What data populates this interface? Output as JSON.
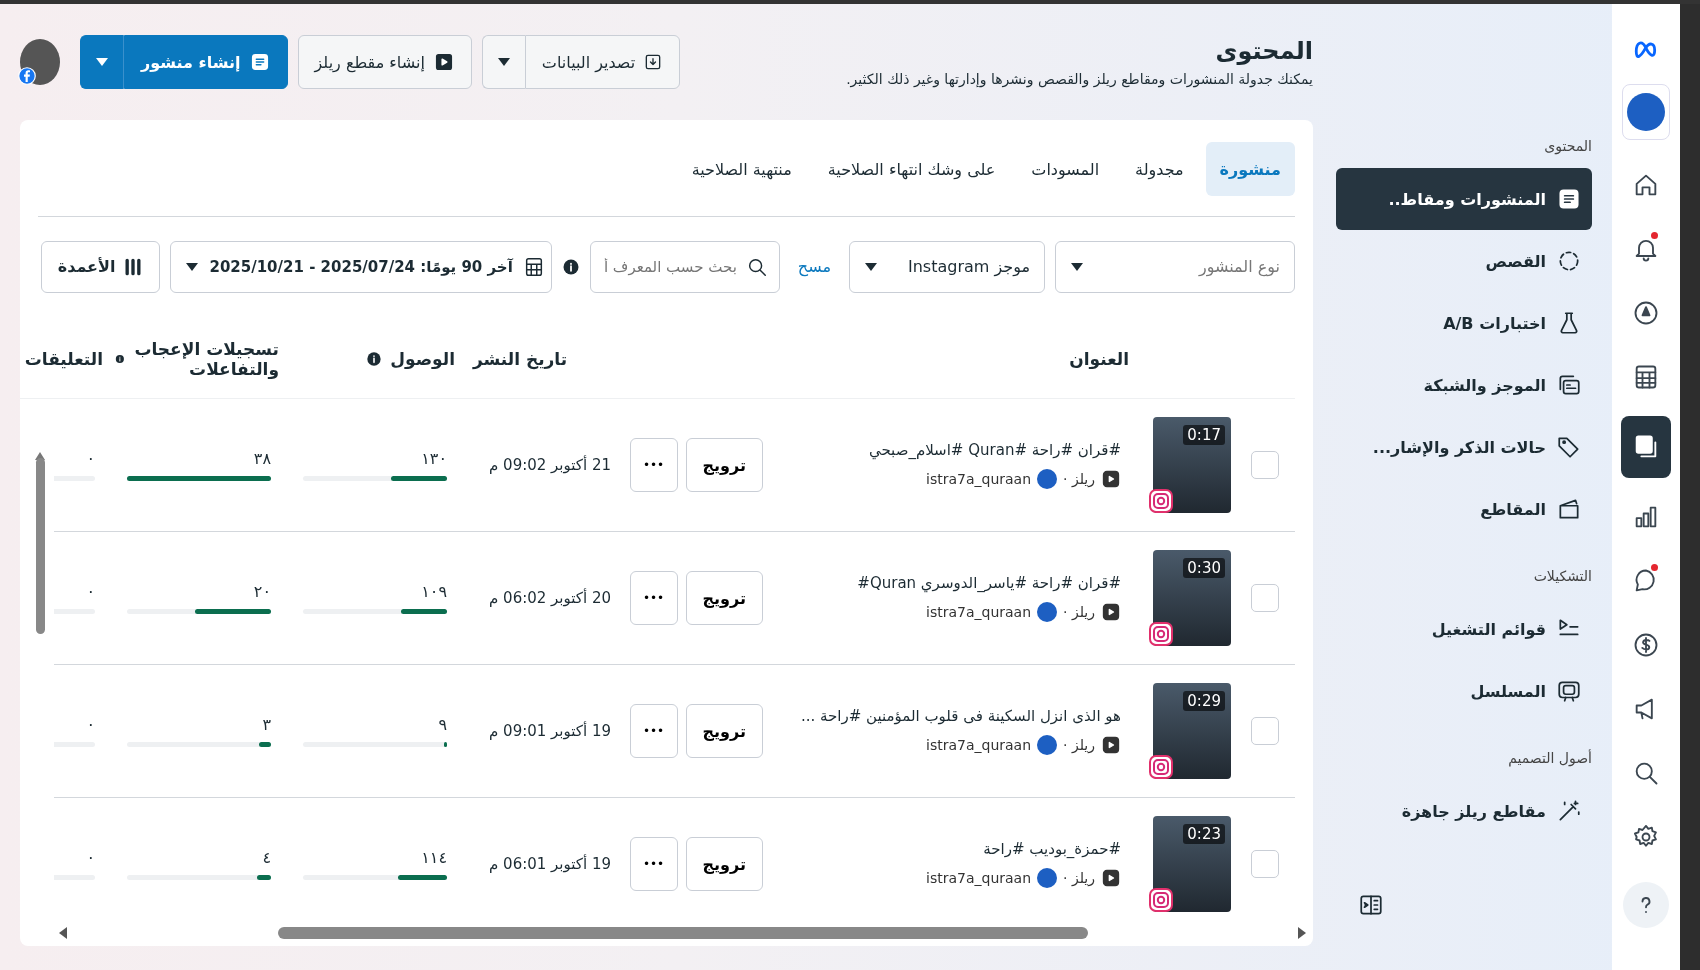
{
  "rail": {
    "items": [
      {
        "selected": false,
        "dot": false
      },
      {
        "selected": false,
        "dot": true
      },
      {
        "selected": false,
        "dot": false
      },
      {
        "selected": false,
        "dot": false
      },
      {
        "selected": true,
        "dot": false
      },
      {
        "selected": false,
        "dot": false
      },
      {
        "selected": false,
        "dot": true
      },
      {
        "selected": false,
        "dot": false
      },
      {
        "selected": false,
        "dot": false
      },
      {
        "selected": false,
        "dot": false
      },
      {
        "selected": false,
        "dot": false
      },
      {
        "selected": false,
        "dot": false
      }
    ]
  },
  "sidebar": {
    "sections": [
      {
        "heading": "المحتوى",
        "items": [
          {
            "label": "المنشورات ومقاط..",
            "selected": true
          },
          {
            "label": "القصص",
            "selected": false
          },
          {
            "label": "اختبارات A/B",
            "selected": false
          },
          {
            "label": "الموجز والشبكة",
            "selected": false
          },
          {
            "label": "حالات الذكر والإشار...",
            "selected": false
          },
          {
            "label": "المقاطع",
            "selected": false
          }
        ]
      },
      {
        "heading": "التشكيلات",
        "items": [
          {
            "label": "قوائم التشغيل",
            "selected": false
          },
          {
            "label": "المسلسل",
            "selected": false
          }
        ]
      },
      {
        "heading": "أصول التصميم",
        "items": [
          {
            "label": "مقاطع ريلز جاهزة",
            "selected": false
          }
        ]
      }
    ]
  },
  "header": {
    "title": "المحتوى",
    "subtitle": "يمكنك جدولة المنشورات ومقاطع ريلز والقصص ونشرها وإدارتها وغير ذلك الكثير.",
    "buttons": [
      {
        "kind": "split",
        "label": "تصدير البيانات"
      },
      {
        "kind": "plain",
        "label": "إنشاء مقطع ريلز"
      },
      {
        "kind": "primary",
        "label": "إنشاء منشور"
      }
    ]
  },
  "tabs": [
    {
      "label": "منشورة",
      "selected": true
    },
    {
      "label": "مجدولة",
      "selected": false
    },
    {
      "label": "المسودات",
      "selected": false
    },
    {
      "label": "على وشك انتهاء الصلاحية",
      "selected": false
    },
    {
      "label": "منتهية الصلاحية",
      "selected": false
    }
  ],
  "filters": {
    "post_type": {
      "placeholder": "نوع المنشور"
    },
    "feed": {
      "value": "موجز Instagram"
    },
    "clear_link": "مسح",
    "search": {
      "placeholder": "بحث حسب المعرف أ"
    },
    "date_range": "آخر 90 يومًا: 2025/07/24 - 2025/10/21",
    "columns_button": "الأعمدة"
  },
  "table": {
    "columns": [
      {
        "label": "العنوان"
      },
      {
        "label": "تاريخ النشر"
      },
      {
        "label": "الوصول",
        "info": true
      },
      {
        "label": "تسجيلات الإعجاب والتفاعلات",
        "info": true
      },
      {
        "label": "التعليقات"
      }
    ],
    "rows": [
      {
        "checked": false,
        "duration": "0:17",
        "title": "#قران #راحة #Quran #اسلام_صبحي",
        "type": "ريلز ·",
        "account": "istra7a_quraan",
        "promote": "ترويج",
        "more": "•••",
        "date": "21 أكتوبر 09:02 م",
        "reach": {
          "value": "١٣٠",
          "level": 0.39
        },
        "likes": {
          "value": "٣٨",
          "level": 1
        },
        "comments": {
          "value": "٠"
        }
      },
      {
        "checked": false,
        "duration": "0:30",
        "title": "#قران #راحة #ياسر_الدوسري Quran#",
        "type": "ريلز ·",
        "account": "istra7a_quraan",
        "promote": "ترويج",
        "more": "•••",
        "date": "20 أكتوبر 06:02 م",
        "reach": {
          "value": "١٠٩",
          "level": 0.32
        },
        "likes": {
          "value": "٢٠",
          "level": 0.53
        },
        "comments": {
          "value": "٠"
        }
      },
      {
        "checked": false,
        "duration": "0:29",
        "title": "هو الذى انزل السكينة فى قلوب المؤمنين #راحة ...",
        "type": "ريلز ·",
        "account": "istra7a_quraan",
        "promote": "ترويج",
        "more": "•••",
        "date": "19 أكتوبر 09:01 م",
        "reach": {
          "value": "٩",
          "level": 0.02
        },
        "likes": {
          "value": "٣",
          "level": 0.08
        },
        "comments": {
          "value": "٠"
        }
      },
      {
        "checked": false,
        "duration": "0:23",
        "title": "#حمزة_بوديب #راحة",
        "type": "ريلز ·",
        "account": "istra7a_quraan",
        "promote": "ترويج",
        "more": "•••",
        "date": "19 أكتوبر 06:01 م",
        "reach": {
          "value": "١١٤",
          "level": 0.34
        },
        "likes": {
          "value": "٤",
          "level": 0.1
        },
        "comments": {
          "value": "٠"
        }
      }
    ]
  }
}
